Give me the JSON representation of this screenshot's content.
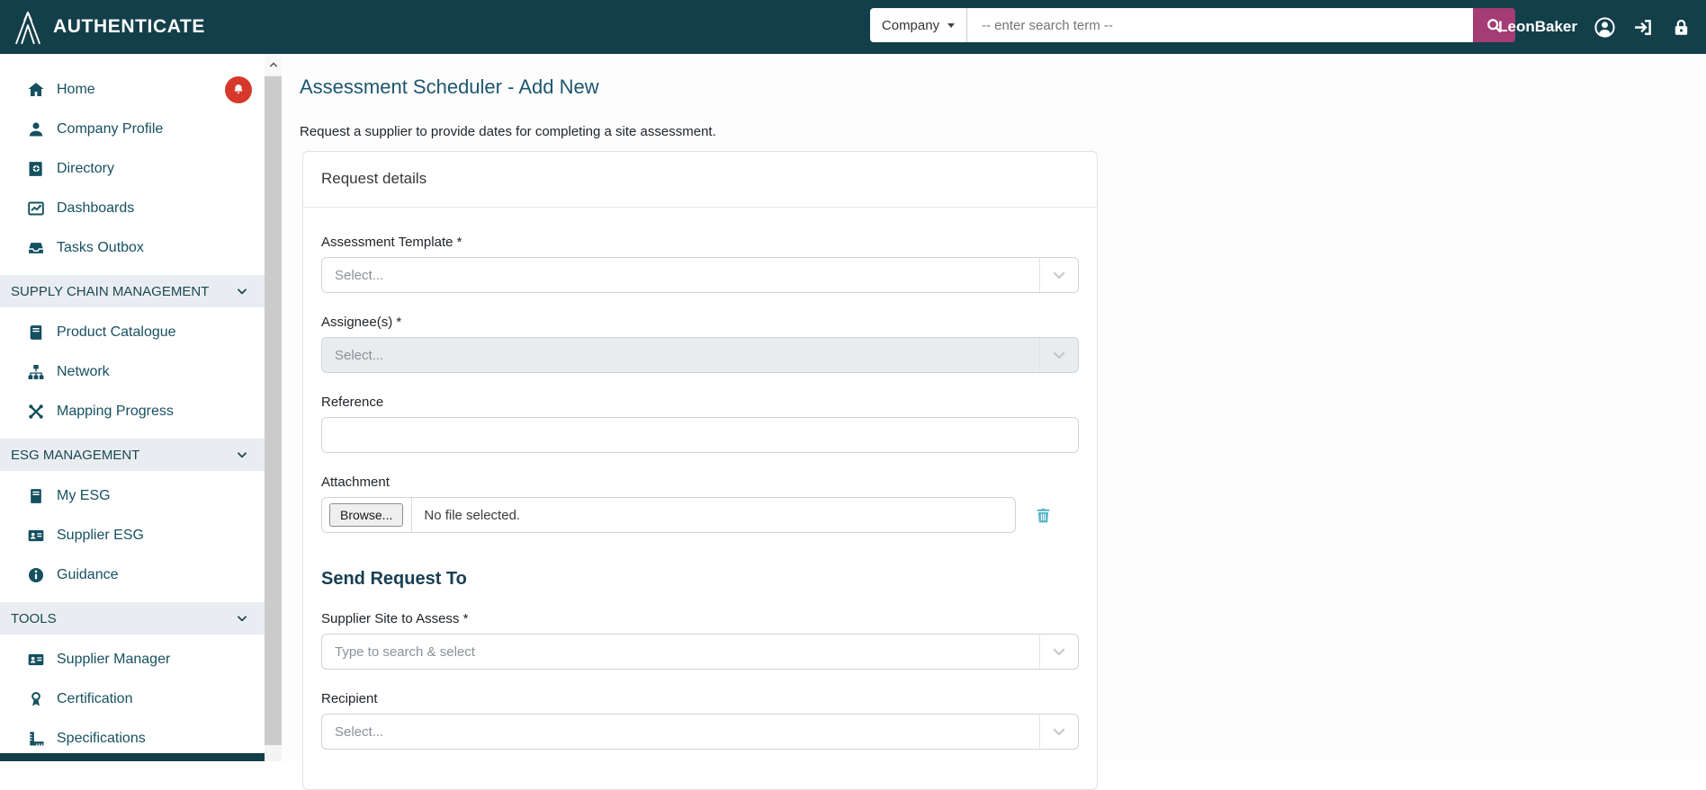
{
  "header": {
    "brand": "AUTHENTICATE",
    "search": {
      "scope": "Company",
      "placeholder": "-- enter search term --"
    },
    "username": "LeonBaker"
  },
  "sidebar": {
    "items": [
      {
        "label": "Home",
        "icon": "home",
        "badge": "bell-notification"
      },
      {
        "label": "Company Profile",
        "icon": "person"
      },
      {
        "label": "Directory",
        "icon": "address-book"
      },
      {
        "label": "Dashboards",
        "icon": "chart-line"
      },
      {
        "label": "Tasks Outbox",
        "icon": "inbox-tray"
      },
      {
        "label": "SUPPLY CHAIN MANAGEMENT",
        "type": "section"
      },
      {
        "label": "Product Catalogue",
        "icon": "book"
      },
      {
        "label": "Network",
        "icon": "sitemap"
      },
      {
        "label": "Mapping Progress",
        "icon": "crossed-tools"
      },
      {
        "label": "ESG MANAGEMENT",
        "type": "section"
      },
      {
        "label": "My ESG",
        "icon": "journal"
      },
      {
        "label": "Supplier ESG",
        "icon": "id-card"
      },
      {
        "label": "Guidance",
        "icon": "info-circle"
      },
      {
        "label": "TOOLS",
        "type": "section"
      },
      {
        "label": "Supplier Manager",
        "icon": "id-card"
      },
      {
        "label": "Certification",
        "icon": "award"
      },
      {
        "label": "Specifications",
        "icon": "ruler"
      }
    ]
  },
  "main": {
    "title": "Assessment Scheduler - Add New",
    "subtitle": "Request a supplier to provide dates for completing a site assessment.",
    "card": {
      "header": "Request details",
      "assessment_template": {
        "label": "Assessment Template *",
        "value": "Select..."
      },
      "assignees": {
        "label": "Assignee(s) *",
        "value": "Select..."
      },
      "reference": {
        "label": "Reference",
        "value": ""
      },
      "attachment": {
        "label": "Attachment",
        "browse": "Browse...",
        "status": "No file selected."
      },
      "send_request_heading": "Send Request To",
      "supplier_site": {
        "label": "Supplier Site to Assess *",
        "placeholder": "Type to search & select"
      },
      "recipient": {
        "label": "Recipient",
        "value": "Select..."
      }
    }
  },
  "colors": {
    "header_bg": "#133F4A",
    "search_button": "#A53C74",
    "notification_badge": "#D6382C",
    "sidebar_text": "#175061",
    "page_title": "#1D566F",
    "section_heading": "#173E51",
    "trash_icon": "#57B4C9"
  }
}
